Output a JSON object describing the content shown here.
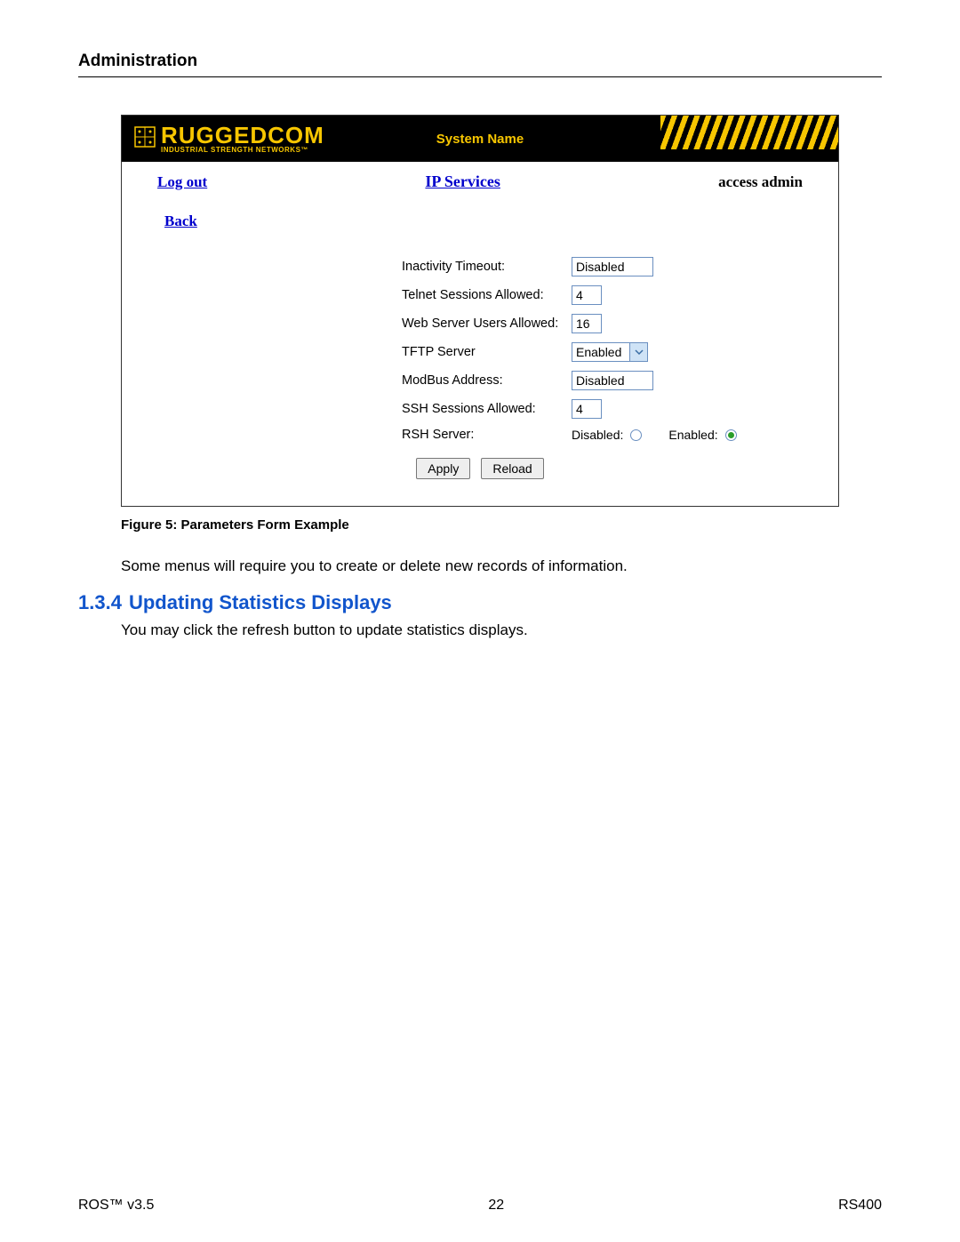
{
  "page": {
    "header": "Administration",
    "figure_caption": "Figure 5: Parameters Form Example",
    "paragraph1": "Some menus will require you to create or delete new records of information.",
    "section_number": "1.3.4",
    "section_title": "Updating Statistics Displays",
    "paragraph2": "You may click the refresh button to update statistics displays."
  },
  "app_header": {
    "logo_main": "RUGGEDCOM",
    "logo_sub": "INDUSTRIAL STRENGTH NETWORKS™",
    "system_name": "System Name"
  },
  "nav": {
    "logout": "Log out",
    "subtitle": "IP Services",
    "access": "access admin",
    "back": "Back"
  },
  "form": {
    "rows": [
      {
        "label": "Inactivity Timeout:",
        "value": "Disabled",
        "type": "text",
        "width": "wide"
      },
      {
        "label": "Telnet Sessions Allowed:",
        "value": "4",
        "type": "text",
        "width": "small"
      },
      {
        "label": "Web Server Users Allowed:",
        "value": "16",
        "type": "text",
        "width": "small"
      },
      {
        "label": "TFTP Server",
        "value": "Enabled",
        "type": "select"
      },
      {
        "label": "ModBus Address:",
        "value": "Disabled",
        "type": "text",
        "width": "wide"
      },
      {
        "label": "SSH Sessions Allowed:",
        "value": "4",
        "type": "text",
        "width": "small"
      },
      {
        "label": "RSH Server:",
        "type": "radio",
        "options": [
          {
            "label": "Disabled:",
            "selected": false
          },
          {
            "label": "Enabled:",
            "selected": true
          }
        ]
      }
    ],
    "apply": "Apply",
    "reload": "Reload"
  },
  "footer": {
    "left": "ROS™  v3.5",
    "center": "22",
    "right": "RS400"
  }
}
